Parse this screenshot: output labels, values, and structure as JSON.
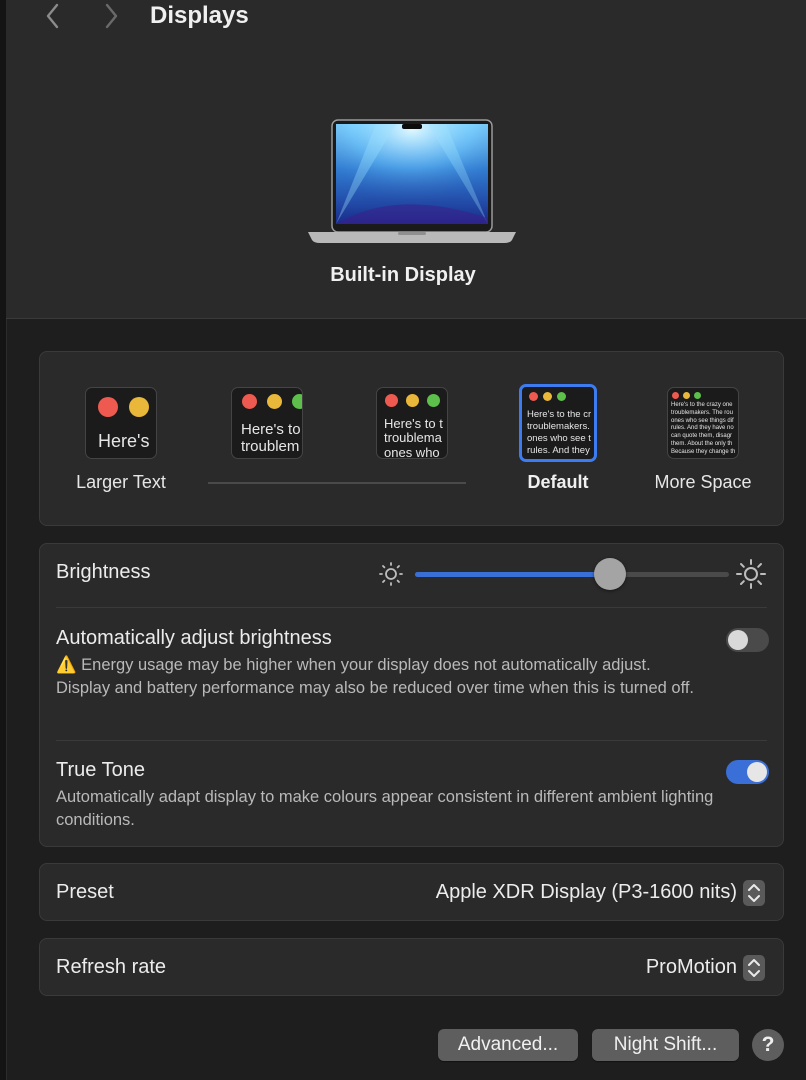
{
  "window": {
    "title": "Displays",
    "back_icon": "chevron-left-icon",
    "forward_icon": "chevron-right-icon"
  },
  "display": {
    "name": "Built-in Display"
  },
  "resolution": {
    "options": [
      {
        "label": "Larger Text",
        "preview": "Here's"
      },
      {
        "label": "",
        "preview": "Here's to\ntroublem"
      },
      {
        "label": "",
        "preview": "Here's to t\ntroublema\nones who"
      },
      {
        "label": "Default",
        "preview": "Here's to the cr\ntroublemakers.\nones who see t\nrules. And they",
        "selected": true
      },
      {
        "label": "More Space",
        "preview": "Here's to the crazy one\ntroublemakers. The rou\nones who see things dif\nrules. And they have no\ncan quote them, disagr\nthem. About the only th\nBecause they change th"
      }
    ]
  },
  "brightness": {
    "label": "Brightness",
    "level_percent": 62,
    "low_icon": "sun-small-icon",
    "high_icon": "sun-large-icon"
  },
  "auto_brightness": {
    "label": "Automatically adjust brightness",
    "warning_icon": "warning-icon",
    "warning": "Energy usage may be higher when your display does not automatically adjust. Display and battery performance may also be reduced over time when this is turned off.",
    "enabled": false
  },
  "true_tone": {
    "label": "True Tone",
    "description": "Automatically adapt display to make colours appear consistent in different ambient lighting conditions.",
    "enabled": true
  },
  "preset": {
    "label": "Preset",
    "value": "Apple XDR Display (P3-1600 nits)"
  },
  "refresh_rate": {
    "label": "Refresh rate",
    "value": "ProMotion"
  },
  "buttons": {
    "advanced": "Advanced...",
    "night_shift": "Night Shift...",
    "help": "?"
  },
  "colors": {
    "accent": "#3a6fd8",
    "background": "#1e1e1e",
    "panel": "#2a2a2a"
  }
}
